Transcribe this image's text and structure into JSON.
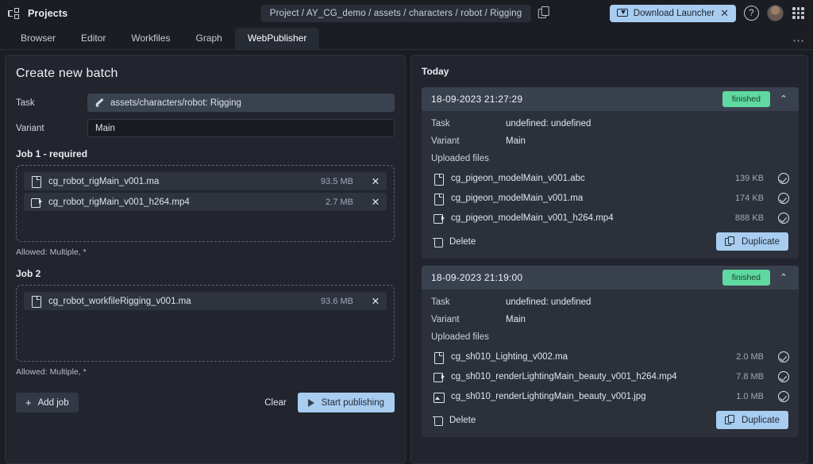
{
  "topbar": {
    "brand_label": "Projects",
    "breadcrumb": "Project / AY_CG_demo / assets / characters / robot / Rigging",
    "download_launcher": "Download Launcher",
    "download_close": "✕",
    "help_glyph": "?"
  },
  "tabs": [
    {
      "label": "Browser",
      "active": false
    },
    {
      "label": "Editor",
      "active": false
    },
    {
      "label": "Workfiles",
      "active": false
    },
    {
      "label": "Graph",
      "active": false
    },
    {
      "label": "WebPublisher",
      "active": true
    }
  ],
  "tab_overflow": "⋯",
  "left": {
    "title": "Create new batch",
    "task_label": "Task",
    "task_value": "assets/characters/robot: Rigging",
    "variant_label": "Variant",
    "variant_value": "Main",
    "jobs": [
      {
        "title": "Job 1 - required",
        "allowed": "Allowed: Multiple, *",
        "files": [
          {
            "icon": "doc",
            "name": "cg_robot_rigMain_v001.ma",
            "size": "93.5 MB",
            "remove": "✕"
          },
          {
            "icon": "vid",
            "name": "cg_robot_rigMain_v001_h264.mp4",
            "size": "2.7 MB",
            "remove": "✕"
          }
        ]
      },
      {
        "title": "Job 2",
        "allowed": "Allowed: Multiple, *",
        "files": [
          {
            "icon": "doc",
            "name": "cg_robot_workfileRigging_v001.ma",
            "size": "93.6 MB",
            "remove": "✕"
          }
        ]
      }
    ],
    "add_job": "Add job",
    "add_job_plus": "+",
    "clear": "Clear",
    "start_publishing": "Start publishing"
  },
  "right": {
    "section_label": "Today",
    "batches": [
      {
        "date": "18-09-2023 21:27:29",
        "status": "finished",
        "chevron": "⌃",
        "task_label": "Task",
        "task_value": "undefined: undefined",
        "variant_label": "Variant",
        "variant_value": "Main",
        "uploaded_label": "Uploaded files",
        "files": [
          {
            "icon": "doc",
            "name": "cg_pigeon_modelMain_v001.abc",
            "size": "139 KB"
          },
          {
            "icon": "doc",
            "name": "cg_pigeon_modelMain_v001.ma",
            "size": "174 KB"
          },
          {
            "icon": "vid",
            "name": "cg_pigeon_modelMain_v001_h264.mp4",
            "size": "888 KB"
          }
        ],
        "delete": "Delete",
        "duplicate": "Duplicate"
      },
      {
        "date": "18-09-2023 21:19:00",
        "status": "finished",
        "chevron": "⌃",
        "task_label": "Task",
        "task_value": "undefined: undefined",
        "variant_label": "Variant",
        "variant_value": "Main",
        "uploaded_label": "Uploaded files",
        "files": [
          {
            "icon": "doc",
            "name": "cg_sh010_Lighting_v002.ma",
            "size": "2.0 MB"
          },
          {
            "icon": "vid",
            "name": "cg_sh010_renderLightingMain_beauty_v001_h264.mp4",
            "size": "7.8 MB"
          },
          {
            "icon": "img",
            "name": "cg_sh010_renderLightingMain_beauty_v001.jpg",
            "size": "1.0 MB"
          }
        ],
        "delete": "Delete",
        "duplicate": "Duplicate"
      }
    ]
  },
  "colors": {
    "accent_blue": "#a8cdf0",
    "status_green": "#5fd9a0",
    "panel_bg": "#22252d",
    "app_bg": "#1b1d23"
  }
}
